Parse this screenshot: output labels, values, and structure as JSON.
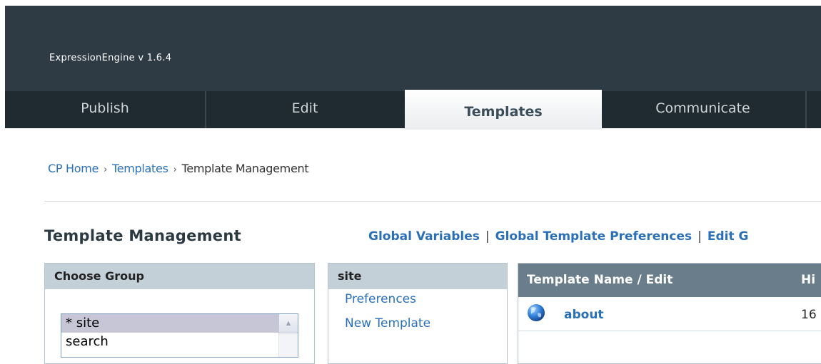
{
  "app": {
    "title": "ExpressionEngine  v 1.6.4"
  },
  "tabs": [
    {
      "label": "Publish",
      "active": false
    },
    {
      "label": "Edit",
      "active": false
    },
    {
      "label": "Templates",
      "active": true
    },
    {
      "label": "Communicate",
      "active": false
    }
  ],
  "breadcrumb": {
    "items": [
      "CP Home",
      "Templates",
      "Template Management"
    ],
    "separator": "›"
  },
  "page": {
    "title": "Template Management"
  },
  "actions": {
    "links": [
      "Global Variables",
      "Global Template Preferences",
      "Edit G"
    ],
    "separator": "|"
  },
  "choose_group": {
    "title": "Choose Group",
    "options": [
      "* site",
      "search"
    ],
    "selected": "* site"
  },
  "group_panel": {
    "title": "site",
    "links": [
      "Preferences",
      "New Template"
    ]
  },
  "templates_table": {
    "columns": [
      "Template Name / Edit",
      "Hi"
    ],
    "rows": [
      {
        "name": "about",
        "hits": "16",
        "icon": "globe-icon"
      }
    ]
  },
  "colors": {
    "header_bg": "#2f3b44",
    "tabbar_bg": "#1f2a31",
    "link": "#2a70b9",
    "panel_head": "#c4d0d7",
    "table_head": "#6a7d8a"
  }
}
